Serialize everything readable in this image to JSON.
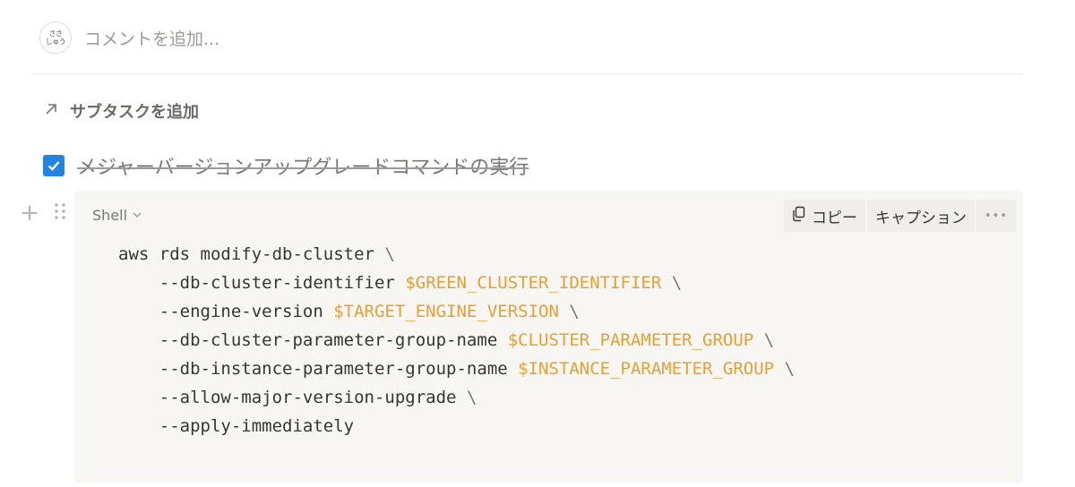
{
  "comment": {
    "avatar_line1": "ささ",
    "avatar_line2": "しゅう",
    "placeholder": "コメントを追加..."
  },
  "subtask": {
    "icon": "arrow-up-right-icon",
    "label": "サブタスクを追加"
  },
  "todo": {
    "checked": true,
    "text": "メジャーバージョンアップグレードコマンドの実行"
  },
  "code_block": {
    "language": "Shell",
    "actions": {
      "copy_label": "コピー",
      "caption_label": "キャプション",
      "more_label": "•••"
    },
    "lines": [
      {
        "indent": "",
        "text": "aws rds modify-db-cluster",
        "var": "",
        "continuation": "\\"
      },
      {
        "indent": "    ",
        "text": "--db-cluster-identifier ",
        "var": "$GREEN_CLUSTER_IDENTIFIER",
        "continuation": "\\"
      },
      {
        "indent": "    ",
        "text": "--engine-version ",
        "var": "$TARGET_ENGINE_VERSION",
        "continuation": "\\"
      },
      {
        "indent": "    ",
        "text": "--db-cluster-parameter-group-name ",
        "var": "$CLUSTER_PARAMETER_GROUP",
        "continuation": "\\"
      },
      {
        "indent": "    ",
        "text": "--db-instance-parameter-group-name ",
        "var": "$INSTANCE_PARAMETER_GROUP",
        "continuation": "\\"
      },
      {
        "indent": "    ",
        "text": "--allow-major-version-upgrade",
        "var": "",
        "continuation": "\\"
      },
      {
        "indent": "    ",
        "text": "--apply-immediately",
        "var": "",
        "continuation": ""
      }
    ]
  },
  "colors": {
    "checkbox": "#2383e2",
    "code_background": "#f7f6f3",
    "variable": "#e6a032"
  }
}
